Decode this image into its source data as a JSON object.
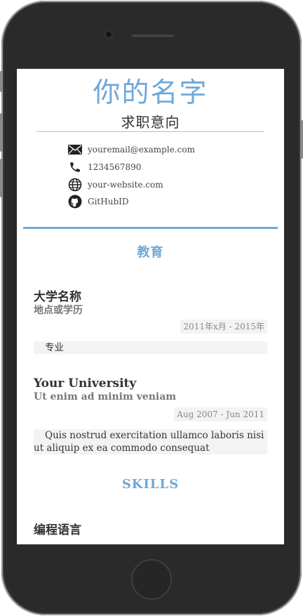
{
  "resume": {
    "name": "你的名字",
    "objective": "求职意向",
    "contacts": {
      "email": "youremail@example.com",
      "phone": "1234567890",
      "website": "your-website.com",
      "github": "GitHubID"
    },
    "sections": {
      "education": {
        "title": "教育",
        "entries": [
          {
            "title": "大学名称",
            "subtitle": "地点或学历",
            "date": "2011年x月 - 2015年",
            "description": "专业"
          },
          {
            "title": "Your University",
            "subtitle": "Ut enim ad minim veniam",
            "date": "Aug 2007 - Jun 2011",
            "description": "Quis nostrud exercitation ullamco laboris nisi ut aliquip ex ea commodo consequat"
          }
        ]
      },
      "skills": {
        "title": "SKILLS",
        "category": "编程语言"
      }
    }
  },
  "colors": {
    "accent": "#6fa8d8",
    "device_body": "#2a2a2a",
    "text": "#333333",
    "muted": "#777777"
  },
  "icons": [
    "envelope-icon",
    "phone-icon",
    "globe-icon",
    "github-icon"
  ]
}
